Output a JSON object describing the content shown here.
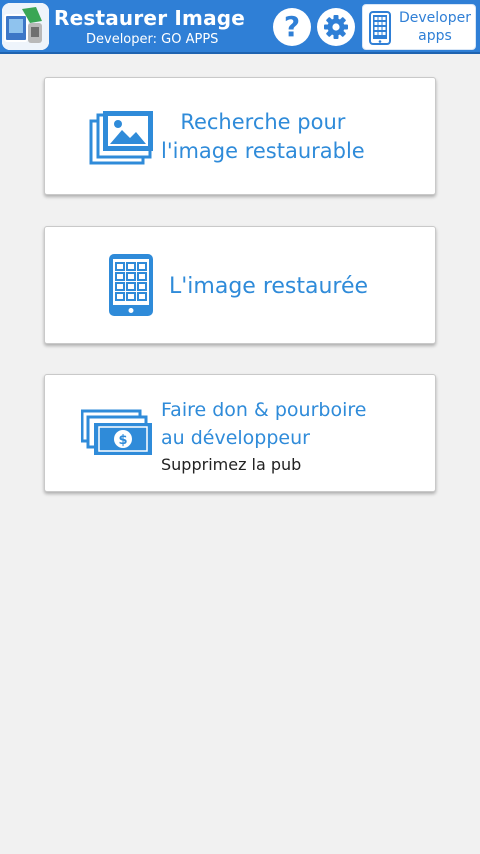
{
  "header": {
    "title": "Restaurer Image",
    "developer": "Developer: GO APPS",
    "help_glyph": "?",
    "developer_apps_line1": "Developer",
    "developer_apps_line2": "apps",
    "bar_color": "#2f7fd6"
  },
  "cards": [
    {
      "line1": "Recherche pour",
      "line2": "l'image restaurable",
      "icon": "image-gallery-icon"
    },
    {
      "line1": "L'image restaurée",
      "icon": "tablet-grid-icon"
    },
    {
      "line1": "Faire don & pourboire",
      "line2": "au développeur",
      "sub": "Supprimez la pub",
      "icon": "money-stack-icon"
    }
  ],
  "accent_color": "#2f8bd9"
}
